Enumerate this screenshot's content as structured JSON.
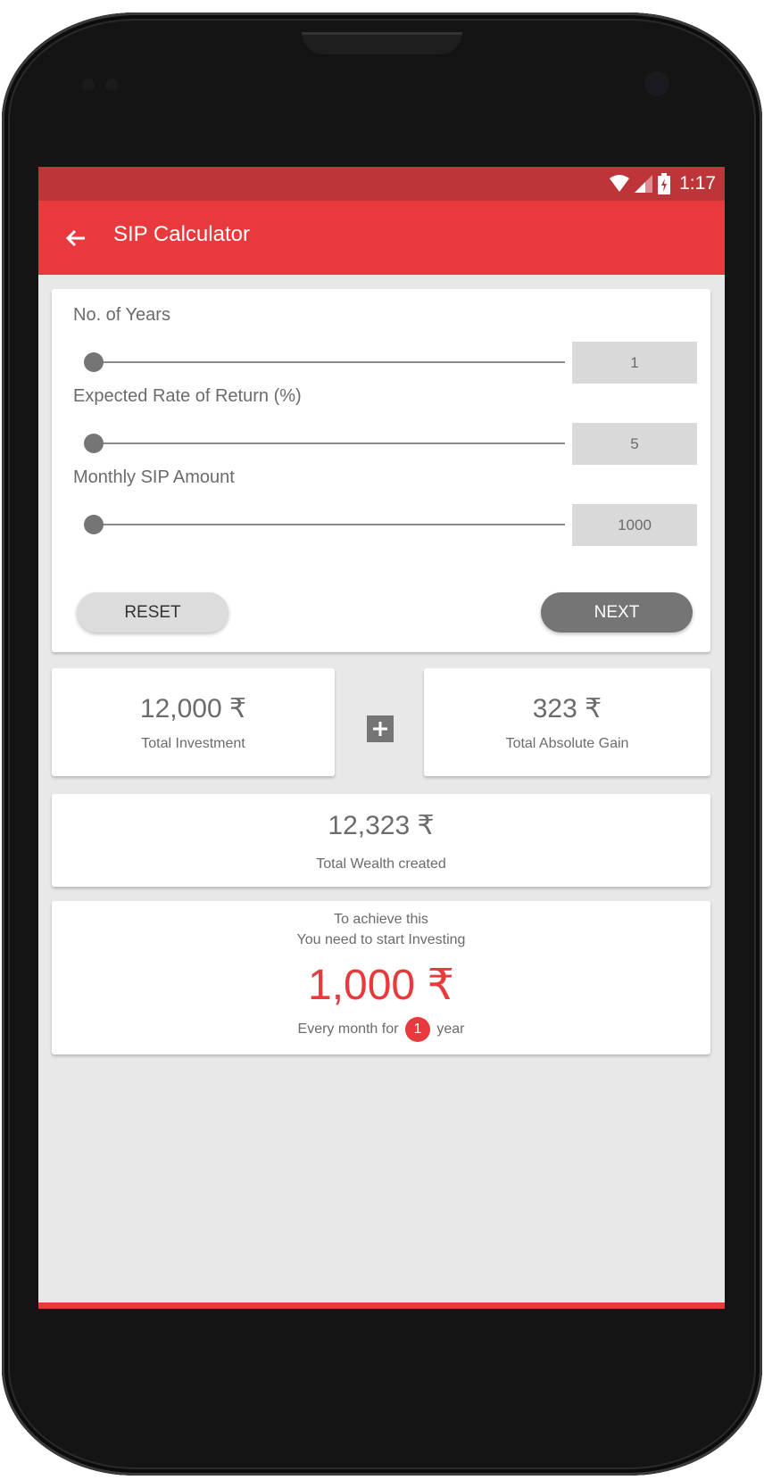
{
  "status_bar": {
    "time": "1:17",
    "icons": [
      "wifi-icon",
      "cell-signal-icon",
      "battery-charging-icon"
    ]
  },
  "app_bar": {
    "title": "SIP Calculator",
    "back_icon": "arrow-back-icon"
  },
  "inputs": [
    {
      "label": "No. of Years",
      "value": "1",
      "slider_fraction": 0.0
    },
    {
      "label": "Expected Rate of Return (%)",
      "value": "5",
      "slider_fraction": 0.0
    },
    {
      "label": "Monthly SIP Amount",
      "value": "1000",
      "slider_fraction": 0.0
    }
  ],
  "buttons": {
    "reset": "RESET",
    "next": "NEXT"
  },
  "results": {
    "total_investment": {
      "value": "12,000 ₹",
      "label": "Total Investment"
    },
    "operator_icon": "plus-icon",
    "total_gain": {
      "value": "323 ₹",
      "label": "Total Absolute Gain"
    },
    "total_wealth": {
      "value": "12,323 ₹",
      "label": "Total Wealth created"
    }
  },
  "achieve": {
    "line1": "To achieve this",
    "line2": "You need to start Investing",
    "amount": "1,000 ₹",
    "prefix": "Every month for",
    "years": "1",
    "suffix": "year"
  },
  "colors": {
    "primary": "#e8393c",
    "status_bar": "#bd3439",
    "background": "#e8e8e8",
    "control_gray": "#757575"
  }
}
